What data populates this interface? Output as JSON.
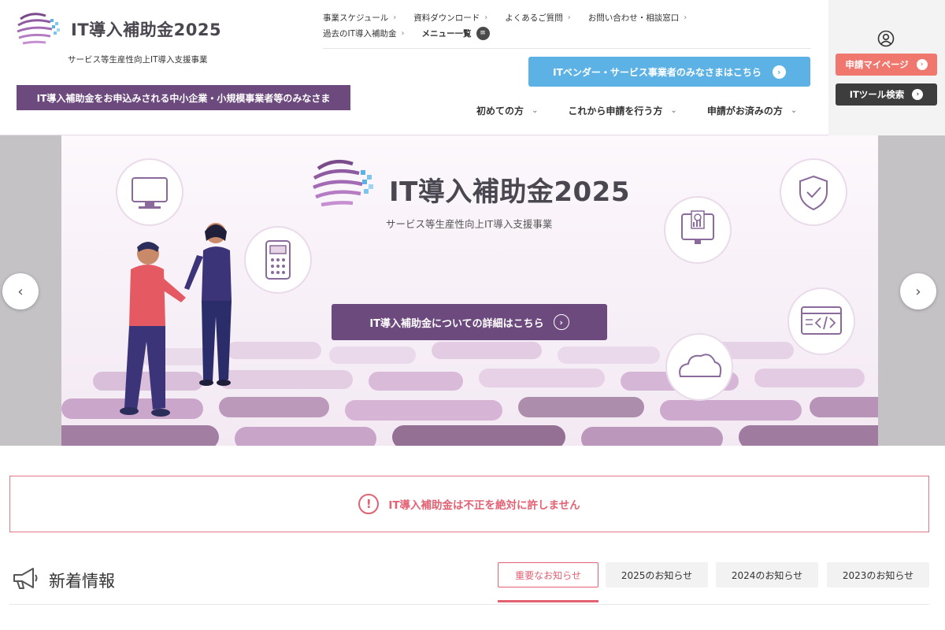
{
  "header": {
    "logo_title": "IT導入補助金2025",
    "tagline": "サービス等生産性向上IT導入支援事業",
    "audience_banner": "IT導入補助金をお申込みされる中小企業・小規模事業者等のみなさま",
    "util_links_row1": [
      "事業スケジュール",
      "資料ダウンロード",
      "よくあるご質問",
      "お問い合わせ・相談窓口"
    ],
    "util_links_row2": [
      "過去のIT導入補助金"
    ],
    "menu_list_label": "メニュー一覧",
    "vendor_button": "ITベンダー・サービス事業者のみなさまはこちら",
    "nav": [
      "初めての方",
      "これから申請を行う方",
      "申請がお済みの方"
    ],
    "mypage_button": "申請マイページ",
    "tool_search_button": "ITツール検索"
  },
  "hero": {
    "logo_title": "IT導入補助金2025",
    "tagline": "サービス等生産性向上IT導入支援事業",
    "cta": "IT導入補助金についての詳細はこちら"
  },
  "notice": {
    "text": "IT導入補助金は不正を絶対に許しません"
  },
  "news": {
    "title": "新着情報",
    "tabs": [
      "重要なお知らせ",
      "2025のお知らせ",
      "2024のお知らせ",
      "2023のお知らせ"
    ],
    "active_tab": "重要なお知らせ"
  },
  "colors": {
    "brand_purple": "#6d4a7d",
    "vendor_blue": "#5db2e5",
    "mypage_coral": "#f0776d",
    "alert_pink": "#e26274"
  },
  "icons": [
    "logo-mark",
    "user-icon",
    "monitor-icon",
    "payment-terminal-icon",
    "invoice-icon",
    "shield-check-icon",
    "code-window-icon",
    "cloud-icon",
    "megaphone-icon",
    "exclamation-icon"
  ]
}
